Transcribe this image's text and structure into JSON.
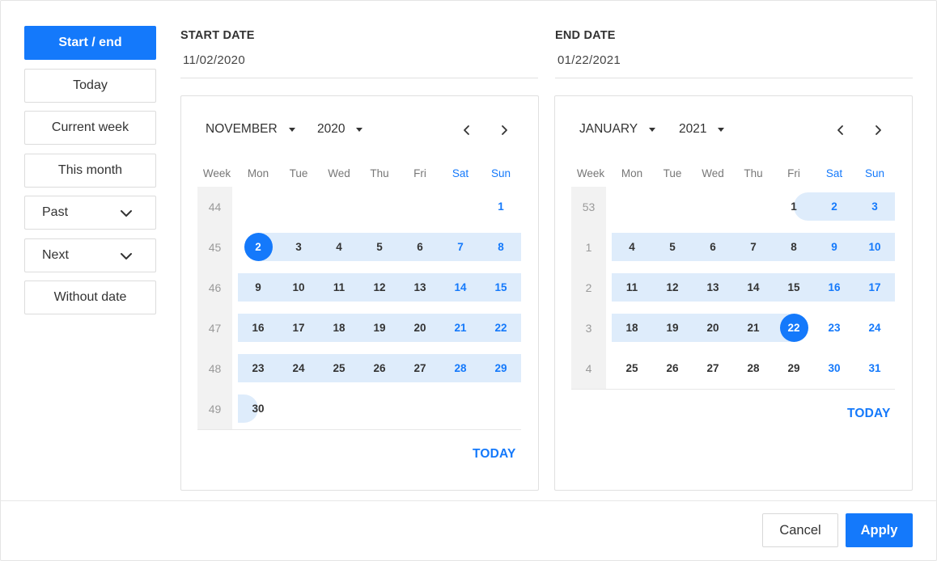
{
  "presets": [
    {
      "label": "Start / end",
      "active": true,
      "dropdown": false
    },
    {
      "label": "Today",
      "active": false,
      "dropdown": false
    },
    {
      "label": "Current week",
      "active": false,
      "dropdown": false
    },
    {
      "label": "This month",
      "active": false,
      "dropdown": false
    },
    {
      "label": "Past",
      "active": false,
      "dropdown": true
    },
    {
      "label": "Next",
      "active": false,
      "dropdown": true
    },
    {
      "label": "Without date",
      "active": false,
      "dropdown": false
    }
  ],
  "start": {
    "label": "START DATE",
    "value": "11/02/2020",
    "calendar": {
      "month": "NOVEMBER",
      "year": "2020",
      "today_label": "TODAY",
      "weekdays": [
        "Week",
        "Mon",
        "Tue",
        "Wed",
        "Thu",
        "Fri",
        "Sat",
        "Sun"
      ],
      "weeks": [
        {
          "num": "44",
          "days": [
            "",
            "",
            "",
            "",
            "",
            "",
            "1"
          ]
        },
        {
          "num": "45",
          "days": [
            "2",
            "3",
            "4",
            "5",
            "6",
            "7",
            "8"
          ]
        },
        {
          "num": "46",
          "days": [
            "9",
            "10",
            "11",
            "12",
            "13",
            "14",
            "15"
          ]
        },
        {
          "num": "47",
          "days": [
            "16",
            "17",
            "18",
            "19",
            "20",
            "21",
            "22"
          ]
        },
        {
          "num": "48",
          "days": [
            "23",
            "24",
            "25",
            "26",
            "27",
            "28",
            "29"
          ]
        },
        {
          "num": "49",
          "days": [
            "30",
            "",
            "",
            "",
            "",
            "",
            ""
          ]
        }
      ],
      "selected": "2"
    }
  },
  "end": {
    "label": "END DATE",
    "value": "01/22/2021",
    "calendar": {
      "month": "JANUARY",
      "year": "2021",
      "today_label": "TODAY",
      "weekdays": [
        "Week",
        "Mon",
        "Tue",
        "Wed",
        "Thu",
        "Fri",
        "Sat",
        "Sun"
      ],
      "weeks": [
        {
          "num": "53",
          "days": [
            "",
            "",
            "",
            "",
            "1",
            "2",
            "3"
          ]
        },
        {
          "num": "1",
          "days": [
            "4",
            "5",
            "6",
            "7",
            "8",
            "9",
            "10"
          ]
        },
        {
          "num": "2",
          "days": [
            "11",
            "12",
            "13",
            "14",
            "15",
            "16",
            "17"
          ]
        },
        {
          "num": "3",
          "days": [
            "18",
            "19",
            "20",
            "21",
            "22",
            "23",
            "24"
          ]
        },
        {
          "num": "4",
          "days": [
            "25",
            "26",
            "27",
            "28",
            "29",
            "30",
            "31"
          ]
        }
      ],
      "selected": "22"
    }
  },
  "icons": {
    "chevron": "chevron-down-icon",
    "prev": "chevron-left-icon",
    "next": "chevron-right-icon"
  },
  "colors": {
    "accent": "#1479fb",
    "range": "#deecfb",
    "week_col": "#f2f2f2"
  },
  "footer": {
    "cancel_label": "Cancel",
    "apply_label": "Apply"
  }
}
